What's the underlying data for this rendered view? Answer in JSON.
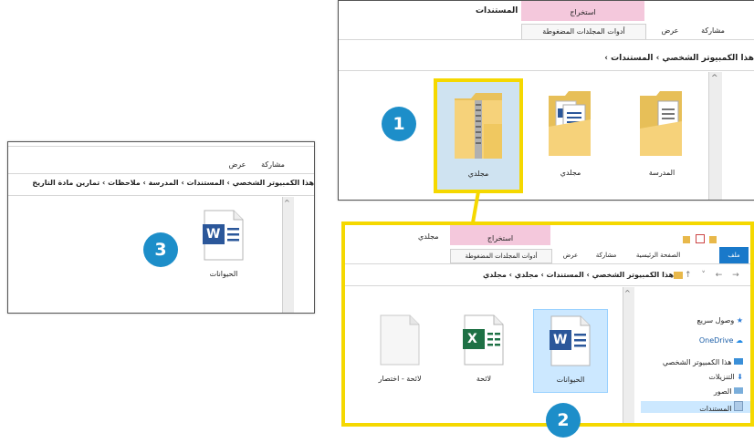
{
  "win1": {
    "title": "المستندات",
    "extract_tab": "استخراج",
    "tab_tools": "أدوات المجلدات المضغوطة",
    "tab_view": "عرض",
    "tab_share": "مشاركة",
    "address": "هذا الكمبيوتر الشخصي  ›  المستندات  ›",
    "items": [
      {
        "label": "مجلدي"
      },
      {
        "label": "مجلدي"
      },
      {
        "label": "المدرسة"
      }
    ]
  },
  "win2": {
    "title": "مجلدي",
    "extract_tab": "استخراج",
    "tab_file": "ملف",
    "tab_home": "الصفحة الرئيسية",
    "tab_share": "مشاركة",
    "tab_view": "عرض",
    "tab_tools": "أدوات المجلدات المضغوطة",
    "address": "هذا الكمبيوتر الشخصي  ›  المستندات  ›  مجلدي  ›  مجلدي",
    "sidebar": [
      {
        "label": "وصول سريع"
      },
      {
        "label": "OneDrive"
      },
      {
        "label": "هذا الكمبيوتر الشخصي"
      },
      {
        "label": "التنزيلات"
      },
      {
        "label": "الصور"
      },
      {
        "label": "المستندات"
      }
    ],
    "files": [
      {
        "label": "الحيوانات"
      },
      {
        "label": "لائحة"
      },
      {
        "label": "لائحة - اختصار"
      }
    ],
    "word_glyph": "W",
    "excel_glyph": "X"
  },
  "win3": {
    "tab_share": "مشاركة",
    "tab_view": "عرض",
    "address": "هذا الكمبيوتر الشخصي  ›  المستندات  ›  المدرسة  ›  ملاحظات  ›  تمارين مادة التاريخ",
    "file": {
      "label": "الحيوانات"
    },
    "word_glyph": "W"
  },
  "badges": [
    "1",
    "2",
    "3"
  ],
  "colors": {
    "highlight": "#f5d800",
    "badge": "#1d8ec9",
    "pink_tab": "#f4c8dc",
    "selection": "#cce8ff",
    "word": "#2b579a",
    "excel": "#1e7145"
  }
}
